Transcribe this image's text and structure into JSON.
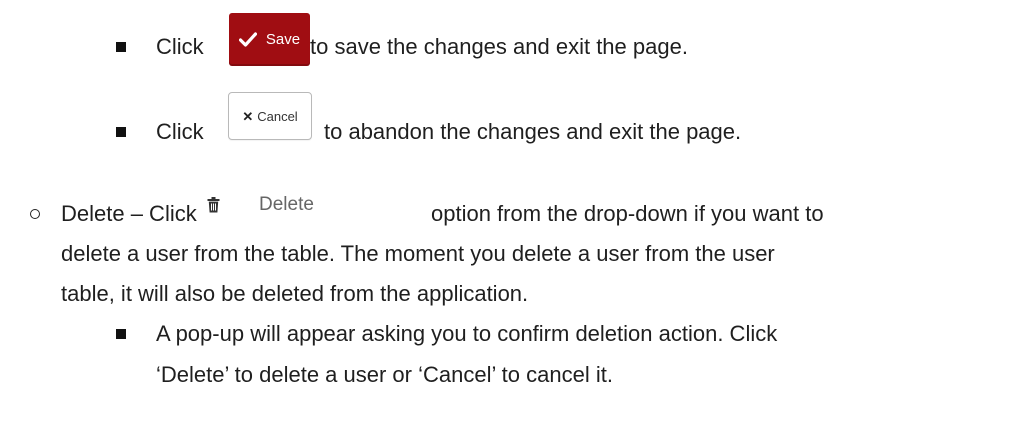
{
  "items": {
    "save_line": {
      "prefix": "Click",
      "button_label": "Save",
      "button_icon": "check-icon",
      "suffix": "to save the changes and exit the page."
    },
    "cancel_line": {
      "prefix": "Click",
      "button_label": "Cancel",
      "button_icon": "x-icon",
      "suffix": "to abandon the changes and exit the page."
    },
    "delete_line": {
      "lead": "Delete – Click",
      "option_label": "Delete",
      "option_icon": "trash-icon",
      "after": "option from the drop-down if you want to",
      "line2": "delete a user from the table. The moment you delete a user from the user",
      "line3": "table, it will also be deleted from the application."
    },
    "popup_line": {
      "line1": "A pop-up will appear asking you to confirm deletion action. Click",
      "line2": "‘Delete’ to delete a user or ‘Cancel’ to cancel it."
    }
  },
  "colors": {
    "save_button": "#a00d12",
    "text": "#1f1f1f"
  }
}
